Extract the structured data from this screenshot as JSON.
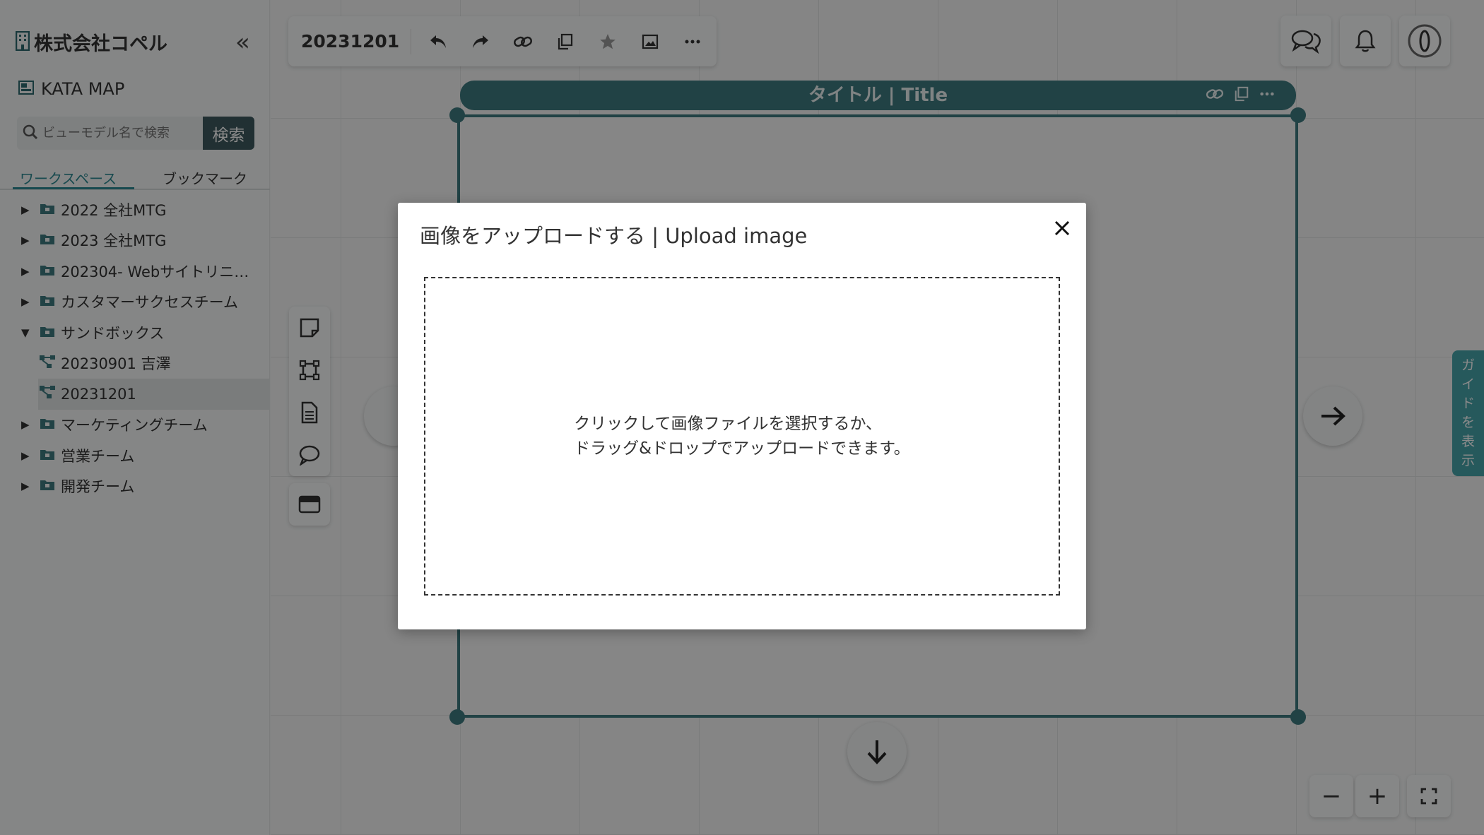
{
  "sidebar": {
    "org_name": "株式会社コペル",
    "collapse_label": "«",
    "app_name": "KATA MAP",
    "search": {
      "placeholder": "ビューモデル名で検索",
      "button": "検索"
    },
    "tabs": {
      "workspace": "ワークスペース",
      "bookmark": "ブックマーク"
    },
    "tree": [
      {
        "label": "2022 全社MTG",
        "expanded": false
      },
      {
        "label": "2023 全社MTG",
        "expanded": false
      },
      {
        "label": "202304- Webサイトリニュ…",
        "expanded": false
      },
      {
        "label": "カスタマーサクセスチーム",
        "expanded": false
      },
      {
        "label": "サンドボックス",
        "expanded": true,
        "children": [
          {
            "label": "20230901 吉澤"
          },
          {
            "label": "20231201",
            "selected": true
          }
        ]
      },
      {
        "label": "マーケティングチーム",
        "expanded": false
      },
      {
        "label": "営業チーム",
        "expanded": false
      },
      {
        "label": "開発チーム",
        "expanded": false
      }
    ]
  },
  "toolbar": {
    "map_title": "20231201"
  },
  "frame": {
    "title": "タイトル | Title"
  },
  "guide": {
    "label": [
      "ガ",
      "イ",
      "ド",
      "を",
      "表",
      "示"
    ]
  },
  "zoom": {
    "out": "−",
    "in": "+"
  },
  "modal": {
    "title": "画像をアップロードする | Upload image",
    "dropzone_line1": "クリックして画像ファイルを選択するか、",
    "dropzone_line2": "ドラッグ&ドロップでアップロードできます。"
  },
  "colors": {
    "accent": "#3e7a80",
    "link": "#2d8a92",
    "guide": "#46a4ab",
    "search_button": "#3d5a5e"
  }
}
